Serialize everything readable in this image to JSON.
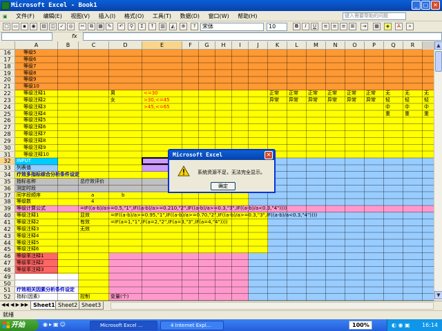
{
  "window": {
    "title": "Microsoft Excel - Book1",
    "minimize": "_",
    "restore": "□",
    "close": "✕"
  },
  "menu": [
    "文件(F)",
    "编辑(E)",
    "视图(V)",
    "插入(I)",
    "格式(O)",
    "工具(T)",
    "数据(D)",
    "窗口(W)",
    "帮助(H)"
  ],
  "help_placeholder": "键入需要帮助的问题",
  "toolbar": {
    "font_name": "宋体",
    "font_size": "10",
    "bold": "B",
    "italic": "I",
    "underline": "U",
    "sum": "Σ"
  },
  "formula_bar": {
    "fx": "fx",
    "name_box": "",
    "formula": ""
  },
  "columns": [
    "A",
    "B",
    "C",
    "D",
    "E",
    "F",
    "G",
    "H",
    "I",
    "J",
    "K",
    "L",
    "M",
    "N",
    "O",
    "P",
    "Q",
    "R"
  ],
  "selected_column": "E",
  "rows": [
    "16",
    "17",
    "18",
    "19",
    "20",
    "21",
    "22",
    "23",
    "24",
    "25",
    "26",
    "27",
    "28",
    "29",
    "30",
    "31",
    "32",
    "33",
    "34",
    "35",
    "36",
    "37",
    "38",
    "39",
    "40",
    "41",
    "42",
    "43",
    "44",
    "45",
    "46",
    "47",
    "48",
    "49",
    "50",
    "51",
    "52"
  ],
  "selected_row": "32",
  "cells": {
    "a16": "等级5",
    "a17": "等级6",
    "a18": "等级7",
    "a19": "等级8",
    "a20": "等级9",
    "a21": "等级10",
    "a22": "等级注释1",
    "a23": "等级注释2",
    "a24": "等级注释3",
    "a25": "等级注释4",
    "a26": "等级注释5",
    "a27": "等级注释6",
    "a28": "等级注释7",
    "a29": "等级注释8",
    "a30": "等级注释9",
    "a31": "等级注释10",
    "a32": "INPUT",
    "a33": "列表值",
    "a34": "疗效多指标综合分析条件设定",
    "a35": "指标名称",
    "c35": "总疗效评价",
    "a36": "测定时段",
    "a37": "同字段顺序",
    "c37": "a",
    "d37": "b",
    "a38": "等级数",
    "c38": "4",
    "a39": "等级计算公式",
    "c39": "=IF((a-b)/a>=0.5,\"1\",IF((a-b)/a>=0.210,\"2\",IF((a-b)/a>=0.3,\"3\",IF((a-b)/a<0.3,\"4\"))))",
    "a40": "等级注释1",
    "c40": "显效",
    "d40": "=IF((a-b)/a>=0.95,\"1\",IF((a-b)/a>=0.70,\"2\",IF((a-b)/a>=0.3,\"3\",IF((a-b)/a<0.3,\"4\"))))",
    "a41": "等级注释2",
    "c41": "有效",
    "d41": "=IF(a=1,\"1\",IF(a=2,\"2\",IF(a=3,\"3\",IF(a=4,\"4\"))))",
    "a42": "等级注释3",
    "c42": "无效",
    "a43": "等级注释4",
    "a44": "等级注释5",
    "a45": "等级注释6",
    "a46": "等级率注释1",
    "a47": "等级率注释2",
    "a48": "等级率注释3",
    "a51": "疗效相关因素分析条件设定",
    "a52": "指标(因素)",
    "c52": "控制",
    "d52": "变量(个)",
    "d22": "男",
    "d23": "女",
    "e22": "<=30",
    "e23": ">30,<=45",
    "e24": ">45,<=65",
    "k22": "正常",
    "k23": "异常",
    "l22": "正常",
    "l23": "异常",
    "m22": "正常",
    "m23": "异常",
    "n22": "正常",
    "n23": "异常",
    "o22": "正常",
    "o23": "异常",
    "p22": "正常",
    "p23": "异常",
    "q22": "无",
    "q23": "轻",
    "q24": "中",
    "q25": "重",
    "r22": "无",
    "r23": "轻",
    "r24": "中",
    "r25": "重",
    "s22": "无",
    "s23": "轻",
    "s24": "中",
    "s25": "重"
  },
  "colors": {
    "orange": "#ff9933",
    "yellow": "#ffff00",
    "cyan": "#00ccff",
    "light_blue": "#99ccff",
    "pink": "#ff99cc",
    "lavender": "#cc99ff",
    "gray": "#c0c0c0",
    "salmon": "#ff6666",
    "red_text": "#ff0000",
    "blue_text": "#0000cc"
  },
  "sheet_tabs": [
    "Sheet1",
    "Sheet2",
    "Sheet3"
  ],
  "status": "就绪",
  "dialog": {
    "title": "Microsoft Excel",
    "message": "系统资源不足，无法完全显示。",
    "ok": "确定"
  },
  "taskbar": {
    "start": "开始",
    "tasks": [
      "Microsoft Excel ...",
      "4 Internet Expl..."
    ],
    "zoom": "100%",
    "clock": "16:14"
  }
}
